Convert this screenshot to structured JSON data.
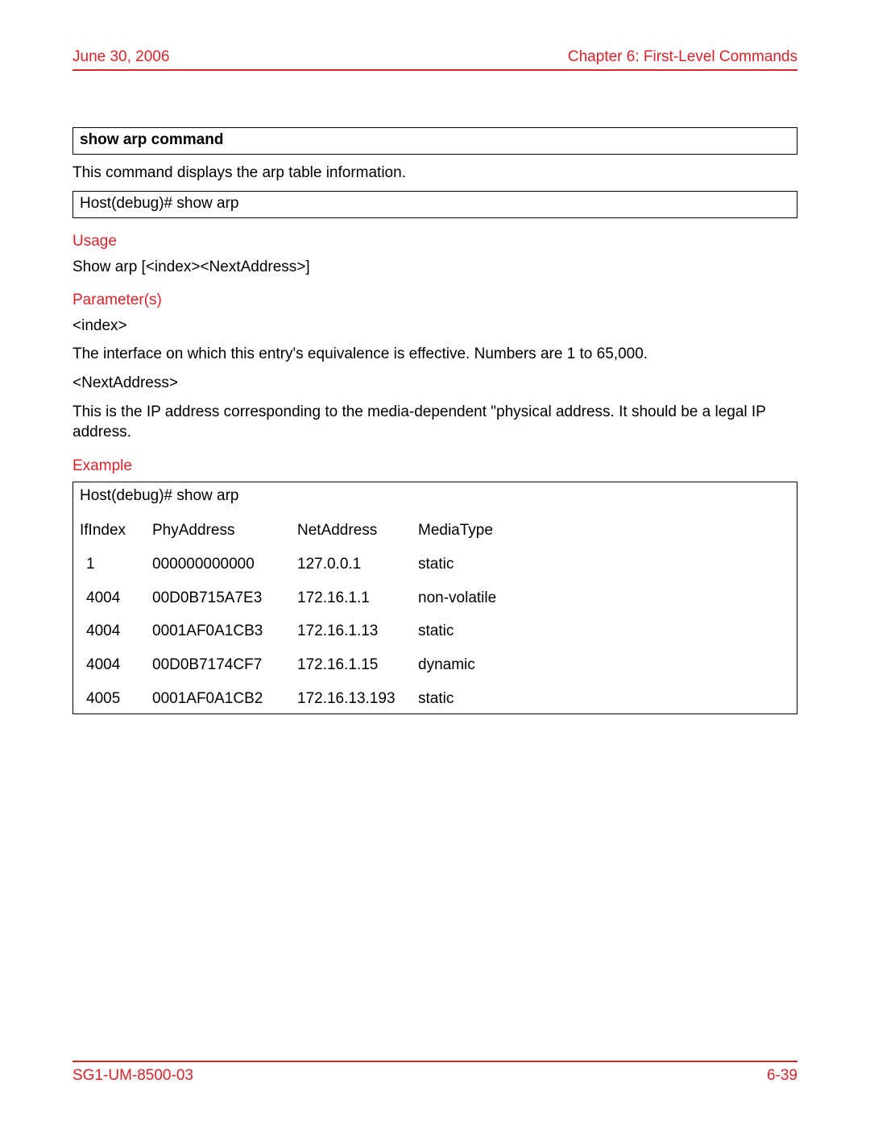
{
  "header": {
    "date": "June 30, 2006",
    "chapter": "Chapter 6: First-Level Commands"
  },
  "footer": {
    "docid": "SG1-UM-8500-03",
    "pagenum": "6-39"
  },
  "command": {
    "title": "show arp command",
    "description": "This command displays the arp table information.",
    "prompt": "Host(debug)# show arp",
    "usage_label": "Usage",
    "usage_syntax": "Show arp [<index><NextAddress>]",
    "parameters_label": "Parameter(s)",
    "params": {
      "p1_name": "<index>",
      "p1_desc": "The interface on which this entry's equivalence is effective. Numbers are 1 to 65,000.",
      "p2_name": "<NextAddress>",
      "p2_desc": "This is the IP address corresponding to the media-dependent \"physical address. It should be a legal IP address."
    },
    "example_label": "Example",
    "example": {
      "cmd": "Host(debug)# show arp",
      "columns": {
        "c1": "IfIndex",
        "c2": "PhyAddress",
        "c3": "NetAddress",
        "c4": "MediaType"
      },
      "rows": [
        {
          "c1": "1",
          "c2": "000000000000",
          "c3": "127.0.0.1",
          "c4": "static"
        },
        {
          "c1": "4004",
          "c2": "00D0B715A7E3",
          "c3": "172.16.1.1",
          "c4": "non-volatile"
        },
        {
          "c1": "4004",
          "c2": "0001AF0A1CB3",
          "c3": "172.16.1.13",
          "c4": "static"
        },
        {
          "c1": "4004",
          "c2": "00D0B7174CF7",
          "c3": "172.16.1.15",
          "c4": "dynamic"
        },
        {
          "c1": "4005",
          "c2": "0001AF0A1CB2",
          "c3": "172.16.13.193",
          "c4": "static"
        }
      ]
    }
  }
}
